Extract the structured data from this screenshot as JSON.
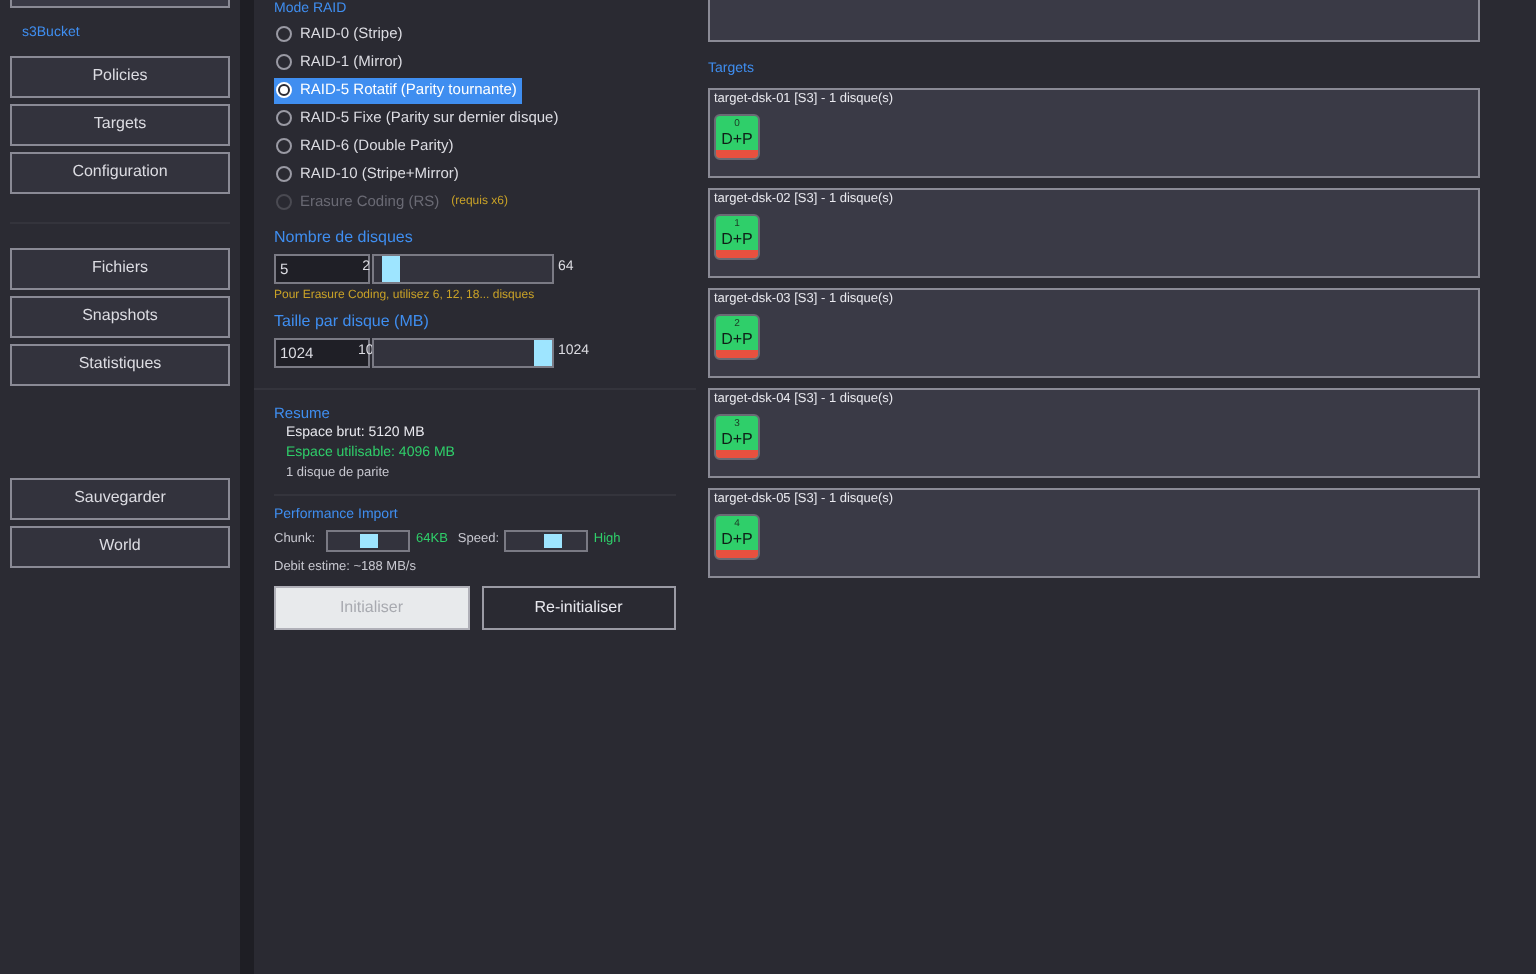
{
  "sidebar": {
    "section_label": "s3Bucket",
    "groups": [
      [
        {
          "label": "Policies"
        },
        {
          "label": "Targets"
        },
        {
          "label": "Configuration"
        }
      ],
      [
        {
          "label": "Fichiers"
        },
        {
          "label": "Snapshots"
        },
        {
          "label": "Statistiques"
        }
      ],
      [
        {
          "label": "Sauvegarder"
        },
        {
          "label": "World"
        }
      ]
    ]
  },
  "raid": {
    "title": "Mode RAID",
    "options": [
      {
        "label": "RAID-0 (Stripe)",
        "selected": false,
        "disabled": false
      },
      {
        "label": "RAID-1 (Mirror)",
        "selected": false,
        "disabled": false
      },
      {
        "label": "RAID-5 Rotatif (Parity tournante)",
        "selected": true,
        "disabled": false
      },
      {
        "label": "RAID-5 Fixe (Parity sur dernier disque)",
        "selected": false,
        "disabled": false
      },
      {
        "label": "RAID-6 (Double Parity)",
        "selected": false,
        "disabled": false
      },
      {
        "label": "RAID-10 (Stripe+Mirror)",
        "selected": false,
        "disabled": false
      },
      {
        "label": "Erasure Coding (RS)",
        "selected": false,
        "disabled": true,
        "note": "(requis x6)"
      }
    ],
    "disk_count": {
      "title": "Nombre de disques",
      "value": "5",
      "min": "2",
      "max": "64",
      "level": 0.05,
      "hint": "Pour Erasure Coding, utilisez 6, 12, 18... disques"
    },
    "disk_size": {
      "title": "Taille par disque (MB)",
      "value": "1024",
      "min": "10",
      "max": "1024",
      "level": 1
    }
  },
  "summary": {
    "title": "Resume",
    "lines": [
      {
        "text": "Espace brut: 5120 MB",
        "kind": "normal"
      },
      {
        "text": "Espace utilisable: 4096 MB",
        "kind": "good"
      },
      {
        "text": "1 disque de parite",
        "kind": "small"
      }
    ]
  },
  "performance": {
    "title": "Performance Import",
    "sliders": [
      {
        "label": "Chunk:",
        "level": 0.5,
        "reading": "64KB"
      },
      {
        "label": "Speed:",
        "level": 0.6,
        "reading": "High"
      }
    ],
    "estimate": "Debit estime: ~188 MB/s"
  },
  "buttons": [
    {
      "label": "Initialiser",
      "disabled": true
    },
    {
      "label": "Re-initialiser",
      "disabled": false
    }
  ],
  "targets": {
    "title": "Targets",
    "items": [
      {
        "label": "target-dsk-01 [S3] - 1 disque(s)",
        "disks": [
          {
            "index": "0",
            "role": "D+P"
          }
        ]
      },
      {
        "label": "target-dsk-02 [S3] - 1 disque(s)",
        "disks": [
          {
            "index": "1",
            "role": "D+P"
          }
        ]
      },
      {
        "label": "target-dsk-03 [S3] - 1 disque(s)",
        "disks": [
          {
            "index": "2",
            "role": "D+P"
          }
        ]
      },
      {
        "label": "target-dsk-04 [S3] - 1 disque(s)",
        "disks": [
          {
            "index": "3",
            "role": "D+P"
          }
        ]
      },
      {
        "label": "target-dsk-05 [S3] - 1 disque(s)",
        "disks": [
          {
            "index": "4",
            "role": "D+P"
          }
        ]
      }
    ]
  }
}
